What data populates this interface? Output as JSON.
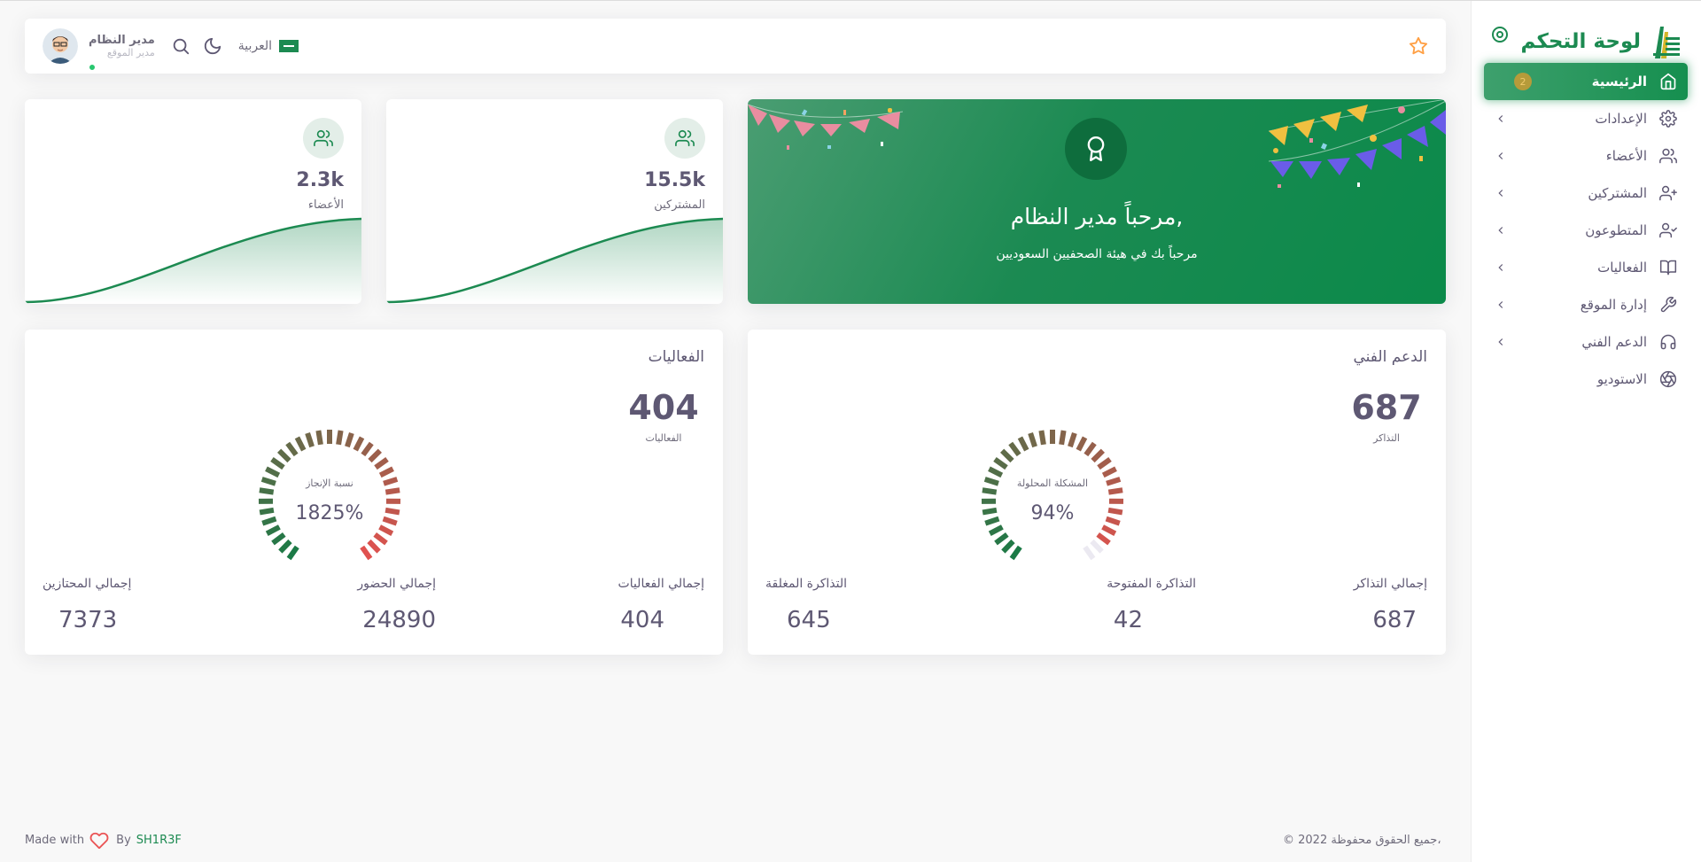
{
  "sidebar": {
    "brand_title": "لوحة التحكم",
    "items": [
      {
        "label": "الرئيسية",
        "icon": "home-icon",
        "badge": "2",
        "active": true
      },
      {
        "label": "الإعدادات",
        "icon": "gear-icon"
      },
      {
        "label": "الأعضاء",
        "icon": "users-icon"
      },
      {
        "label": "المشتركين",
        "icon": "user-plus-icon"
      },
      {
        "label": "المتطوعون",
        "icon": "user-check-icon"
      },
      {
        "label": "الفعاليات",
        "icon": "book-open-icon"
      },
      {
        "label": "إدارة الموقع",
        "icon": "wrench-icon"
      },
      {
        "label": "الدعم الفني",
        "icon": "headphones-icon"
      },
      {
        "label": "الاستوديو",
        "icon": "aperture-icon"
      }
    ]
  },
  "topbar": {
    "user_name": "مدير النظام",
    "user_role": "مدير الموقع",
    "language": "العربية"
  },
  "welcome": {
    "title": "مرحباً مدير النظام,",
    "subtitle": "مرحباً بك في هيئة الصحفيين السعوديين"
  },
  "stats": [
    {
      "value": "15.5k",
      "label": "المشتركين"
    },
    {
      "value": "2.3k",
      "label": "الأعضاء"
    }
  ],
  "support": {
    "title": "الدعم الفني",
    "value": "687",
    "value_label": "التذاكر",
    "gauge_label": "المشكلة المحلولة",
    "gauge_percent": "94%",
    "gauge_fraction": 0.94,
    "totals": [
      {
        "label": "إجمالي التذاكر",
        "value": "687"
      },
      {
        "label": "التذاكرة المفتوحة",
        "value": "42"
      },
      {
        "label": "التذاكرة المغلقة",
        "value": "645"
      }
    ]
  },
  "events": {
    "title": "الفعاليات",
    "value": "404",
    "value_label": "الفعاليات",
    "gauge_label": "نسبة الإنجاز",
    "gauge_percent": "1825%",
    "gauge_fraction": 1.0,
    "totals": [
      {
        "label": "إجمالي الفعاليات",
        "value": "404"
      },
      {
        "label": "إجمالي الحضور",
        "value": "24890"
      },
      {
        "label": "إجمالي المحتازين",
        "value": "7373"
      }
    ]
  },
  "footer": {
    "made_with": "Made with",
    "by": "By",
    "author": "SH1R3F",
    "copyright": "© 2022 جميع الحقوق محفوظة،"
  },
  "colors": {
    "brand": "#1c8a51",
    "gauge_start": "#1b7a46",
    "gauge_end": "#e0514f"
  }
}
